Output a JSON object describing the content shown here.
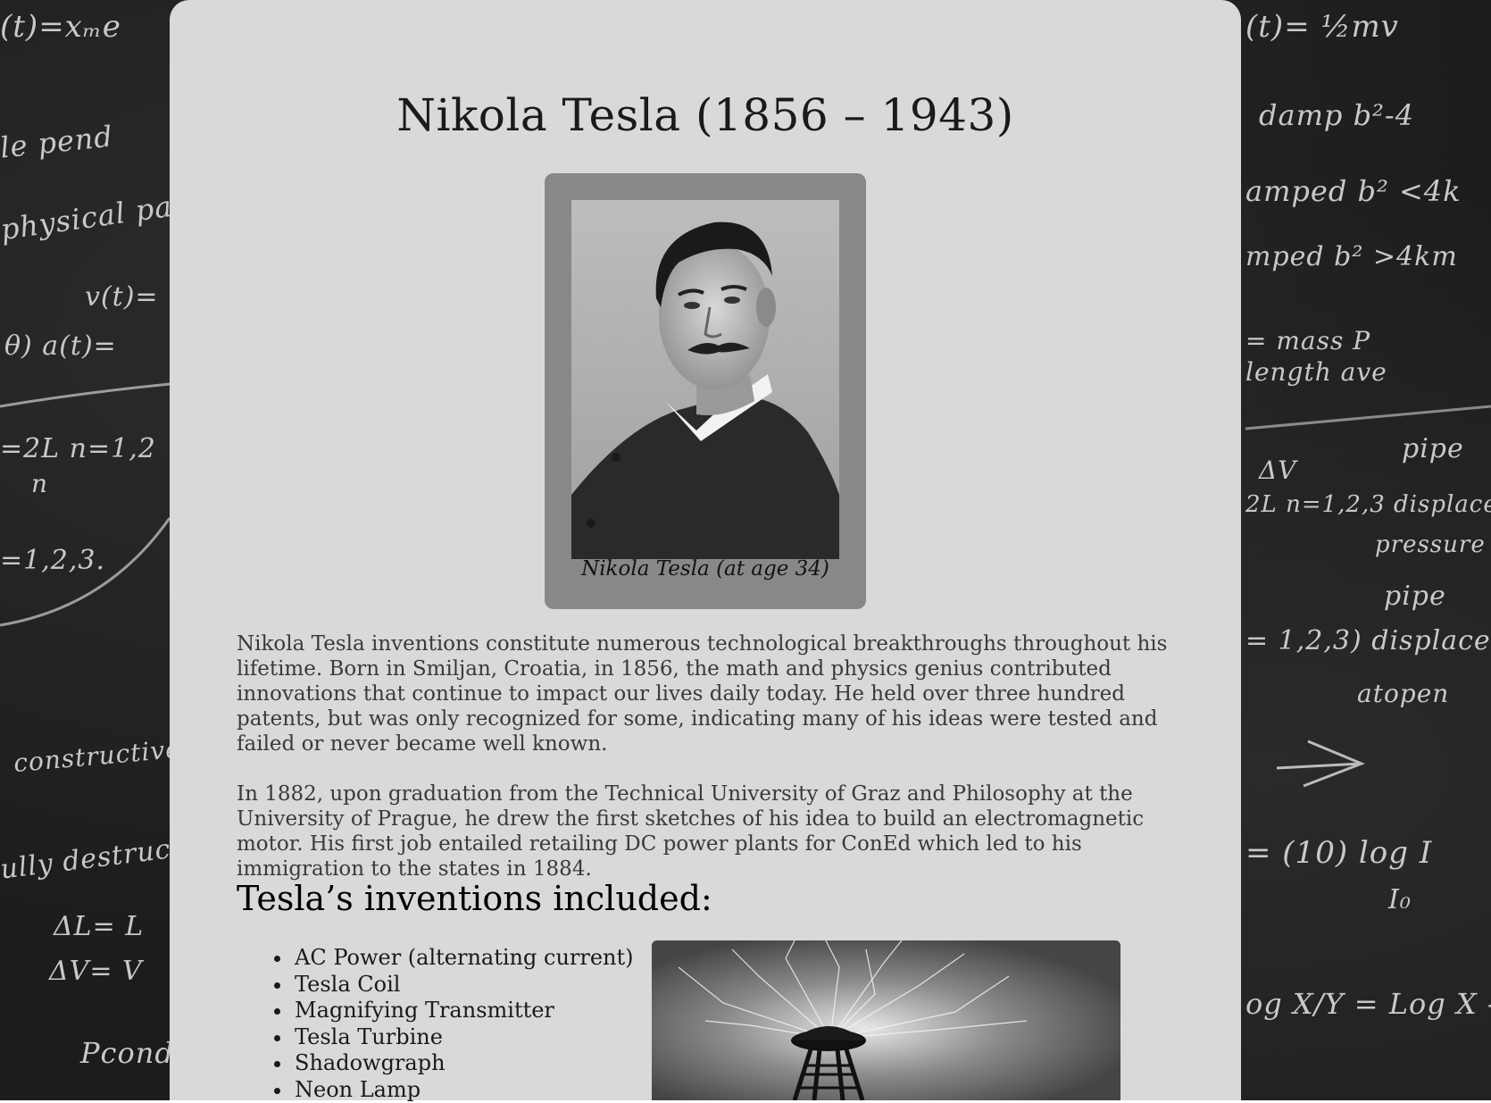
{
  "page": {
    "title": "Nikola Tesla (1856 – 1943)",
    "portrait_caption": "Nikola Tesla (at age 34)",
    "paragraphs": [
      "Nikola Tesla inventions constitute numerous technological breakthroughs throughout his lifetime. Born in Smiljan, Croatia, in 1856, the math and physics genius contributed innovations that continue to impact our lives daily today. He held over three hundred patents, but was only recognized for some, indicating many of his ideas were tested and failed or never became well known.",
      "In 1882, upon graduation from the Technical University of Graz and Philosophy at the University of Prague, he drew the first sketches of his idea to build an electromagnetic motor. His first job entailed retailing DC power plants for ConEd which led to his immigration to the states in 1884."
    ],
    "inventions_heading": "Tesla’s inventions included:",
    "inventions": [
      "AC Power (alternating current)",
      "Tesla Coil",
      "Magnifying Transmitter",
      "Tesla Turbine",
      "Shadowgraph",
      "Neon Lamp"
    ]
  },
  "background": {
    "chalk_left": [
      "(t)=xₘe",
      "le pend",
      "physical pa",
      "v(t)=",
      "θ) a(t)=",
      "=2L   n=1,2",
      "n",
      "=1,2,3.",
      "constructive",
      "ully destruc",
      "ΔL= L",
      "ΔV= V",
      "Pcond"
    ],
    "chalk_right": [
      "(t)= ½mv",
      "damp   b²-4",
      "amped  b² <4k",
      "mped b² >4km",
      "= mass   P",
      "  length   ave",
      "pipe",
      "ΔV",
      "2L   n=1,2,3  displace",
      "pressure",
      "pipe",
      "= 1,2,3) displace",
      "atopen",
      "= (10) log I",
      "I₀",
      "og X/Y = Log X - L"
    ]
  },
  "colors": {
    "panel": "#d9d9d9",
    "frame": "#888888",
    "board": "#1c1c1c",
    "chalk": "#e6e6e6"
  }
}
